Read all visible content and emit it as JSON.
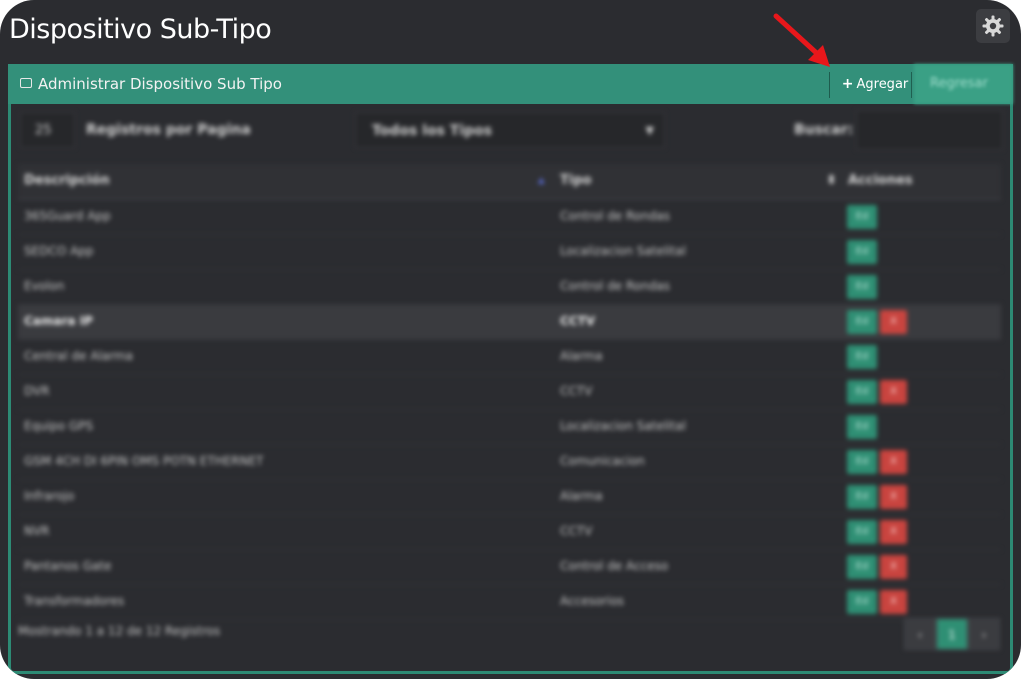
{
  "page": {
    "title": "Dispositivo Sub-Tipo"
  },
  "panel": {
    "title": "Administrar Dispositivo Sub Tipo",
    "add_label": "Agregar",
    "back_label": "Regresar"
  },
  "toolbar": {
    "per_page_value": "25",
    "per_page_label": "Registros por Pagina",
    "type_filter_value": "Todos los Tipos",
    "search_label": "Buscar:",
    "search_value": ""
  },
  "table": {
    "headers": {
      "description": "Descripción",
      "type": "Tipo",
      "actions": "Acciones"
    },
    "edit_label": "Ed",
    "delete_label": "X",
    "rows": [
      {
        "description": "365Guard App",
        "type": "Control de Rondas",
        "edit": true,
        "delete": false
      },
      {
        "description": "SEDCO App",
        "type": "Localizacion Satelital",
        "edit": true,
        "delete": false
      },
      {
        "description": "Evolon",
        "type": "Control de Rondas",
        "edit": true,
        "delete": false
      },
      {
        "description": "Camara IP",
        "type": "CCTV",
        "edit": true,
        "delete": true,
        "highlight": true
      },
      {
        "description": "Central de Alarma",
        "type": "Alarma",
        "edit": true,
        "delete": false
      },
      {
        "description": "DVR",
        "type": "CCTV",
        "edit": true,
        "delete": true
      },
      {
        "description": "Equipo GPS",
        "type": "Localizacion Satelital",
        "edit": true,
        "delete": false
      },
      {
        "description": "GSM 4CH DI 6PIN OMS POTN ETHERNET",
        "type": "Comunicacion",
        "edit": true,
        "delete": true
      },
      {
        "description": "Infrarojo",
        "type": "Alarma",
        "edit": true,
        "delete": true
      },
      {
        "description": "NVR",
        "type": "CCTV",
        "edit": true,
        "delete": true
      },
      {
        "description": "Pantanos Gate",
        "type": "Control de Acceso",
        "edit": true,
        "delete": true
      },
      {
        "description": "Transformadores",
        "type": "Accesorios",
        "edit": true,
        "delete": true
      }
    ]
  },
  "footer": {
    "info": "Mostrando 1 a 12 de 12 Registros",
    "prev": "‹",
    "current_page": "1",
    "next": "›"
  },
  "colors": {
    "accent": "#33907a",
    "danger": "#c9443f",
    "background": "#2b2c30",
    "annotation_arrow": "#e8171b"
  },
  "icons": [
    "gear-icon",
    "drive-icon",
    "plus-icon",
    "arrow-annotation"
  ]
}
